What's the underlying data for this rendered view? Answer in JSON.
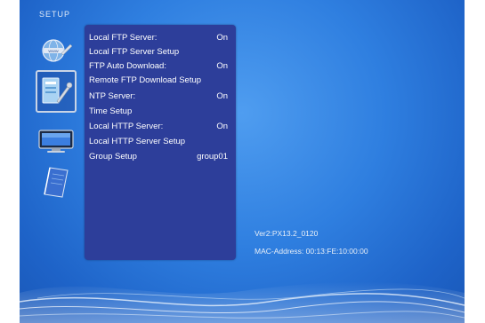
{
  "screen": {
    "title": "SETUP"
  },
  "nav": {
    "items": [
      {
        "name": "network-globe-icon"
      },
      {
        "name": "settings-tools-icon",
        "selected": true
      },
      {
        "name": "monitor-icon"
      },
      {
        "name": "book-icon"
      }
    ]
  },
  "menu": {
    "items": [
      {
        "label": "Local FTP Server:",
        "value": "On"
      },
      {
        "label": "Local FTP Server Setup",
        "value": ""
      },
      {
        "label": "FTP Auto Download:",
        "value": "On"
      },
      {
        "label": "Remote FTP Download Setup",
        "value": ""
      },
      {
        "label": "NTP Server:",
        "value": "On"
      },
      {
        "label": "Time Setup",
        "value": ""
      },
      {
        "label": "Local HTTP Server:",
        "value": "On"
      },
      {
        "label": "Local HTTP Server Setup",
        "value": ""
      },
      {
        "label": "Group Setup",
        "value": "group01"
      }
    ]
  },
  "info": {
    "version": "Ver2:PX13.2_0120",
    "mac": "MAC-Address: 00:13:FE:10:00:00"
  },
  "colors": {
    "background": "#2f7fe0",
    "menu_panel": "#2d3e9a",
    "text": "#ffffff"
  }
}
